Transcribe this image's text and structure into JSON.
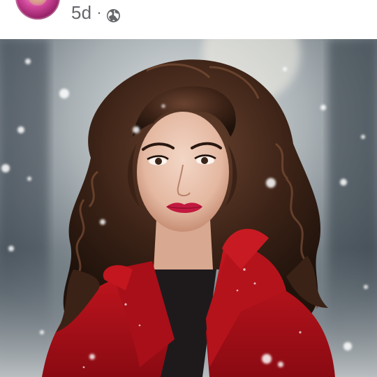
{
  "post": {
    "timestamp": "5d",
    "separator": "·",
    "audience_icon": "globe-icon"
  },
  "photo": {
    "subject": "woman",
    "palette": {
      "coat": "#b3121b",
      "lips": "#c2193f",
      "hair": "#3b2216",
      "skin": "#e9c2ad"
    }
  },
  "colors": {
    "meta_text": "#65676b",
    "background": "#ffffff"
  }
}
